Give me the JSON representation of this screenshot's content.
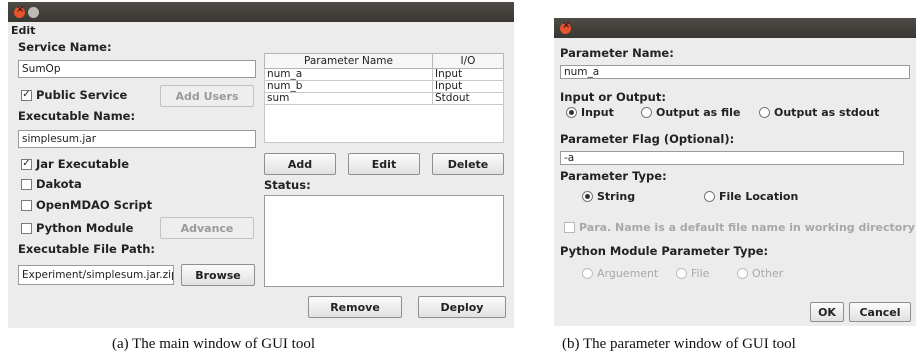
{
  "main_window": {
    "menu": {
      "edit": "Edit"
    },
    "service_name_label": "Service Name:",
    "service_name_value": "SumOp",
    "public_service": {
      "label": "Public Service",
      "checked": true
    },
    "add_users_button": "Add Users",
    "executable_name_label": "Executable Name:",
    "executable_name_value": "simplesum.jar",
    "options": [
      {
        "label": "Jar Executable",
        "checked": true
      },
      {
        "label": "Dakota",
        "checked": false
      },
      {
        "label": "OpenMDAO Script",
        "checked": false
      },
      {
        "label": "Python Module",
        "checked": false
      }
    ],
    "advance_button": "Advance",
    "executable_path_label": "Executable File Path:",
    "executable_path_value": "Experiment/simplesum.jar.zip",
    "browse_button": "Browse",
    "table": {
      "headers": [
        "Parameter Name",
        "I/O"
      ],
      "rows": [
        [
          "num_a",
          "Input"
        ],
        [
          "num_b",
          "Input"
        ],
        [
          "sum",
          "Stdout"
        ]
      ]
    },
    "add_button": "Add",
    "edit_button": "Edit",
    "delete_button": "Delete",
    "status_label": "Status:",
    "remove_button": "Remove",
    "deploy_button": "Deploy"
  },
  "param_window": {
    "param_name_label": "Parameter Name:",
    "param_name_value": "num_a",
    "io_label": "Input or Output:",
    "io_options": [
      "Input",
      "Output as file",
      "Output as stdout"
    ],
    "io_selected": "Input",
    "flag_label": "Parameter Flag (Optional):",
    "flag_value": "-a",
    "type_label": "Parameter Type:",
    "type_options": [
      "String",
      "File Location"
    ],
    "type_selected": "String",
    "default_file_checkbox": "Para. Name is a default file name in working directory",
    "python_type_label": "Python Module Parameter Type:",
    "python_type_options": [
      "Arguement",
      "File",
      "Other"
    ],
    "ok_button": "OK",
    "cancel_button": "Cancel"
  },
  "captions": {
    "a": "(a) The main window of GUI tool",
    "b": "(b) The parameter window of GUI tool"
  }
}
